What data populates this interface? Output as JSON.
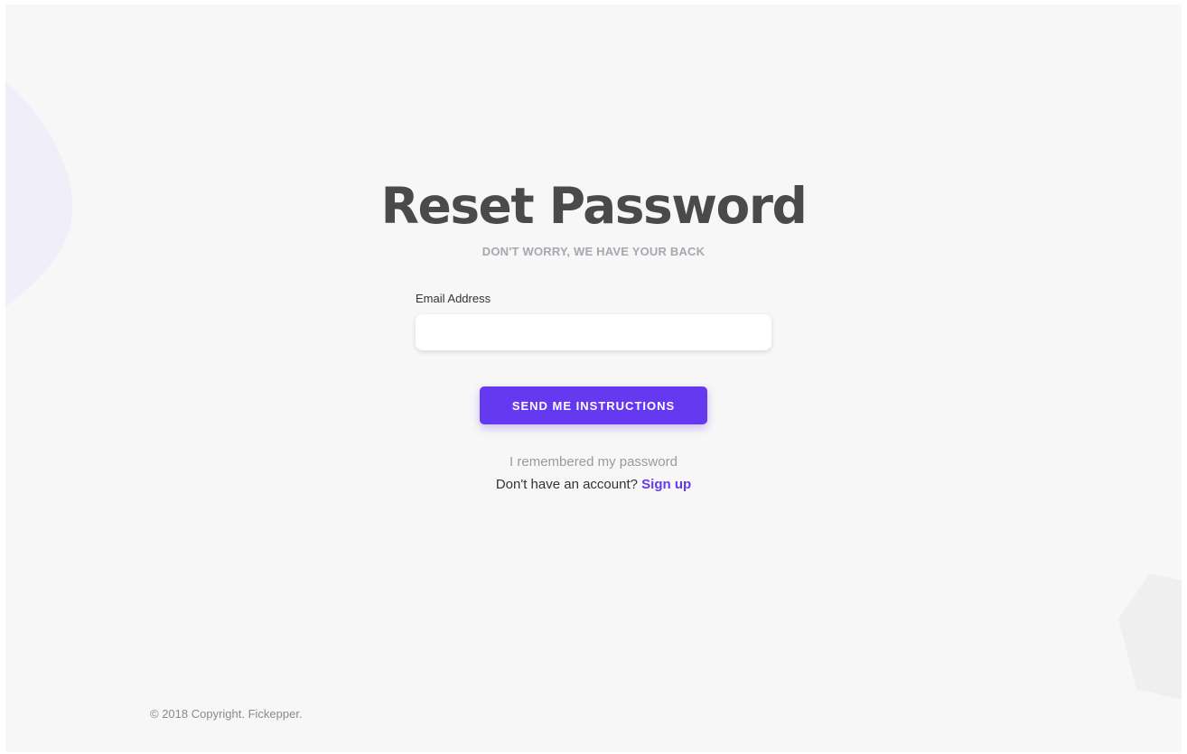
{
  "colors": {
    "background": "#f7f7f7",
    "accent": "#6439ef",
    "title": "#4a4a4a",
    "subtitle": "#a7a7b0",
    "blob_left": "#efeef9",
    "blob_right": "#efefef"
  },
  "header": {
    "title": "Reset Password",
    "subtitle": "DON'T WORRY, WE HAVE YOUR BACK"
  },
  "form": {
    "email_label": "Email Address",
    "email_value": "",
    "email_placeholder": "",
    "submit_label": "SEND ME INSTRUCTIONS"
  },
  "links": {
    "remember": "I remembered my password",
    "no_account_text": "Don't have an account?",
    "signup": "Sign up"
  },
  "footer": {
    "copyright": "© 2018 Copyright. Fickepper."
  }
}
